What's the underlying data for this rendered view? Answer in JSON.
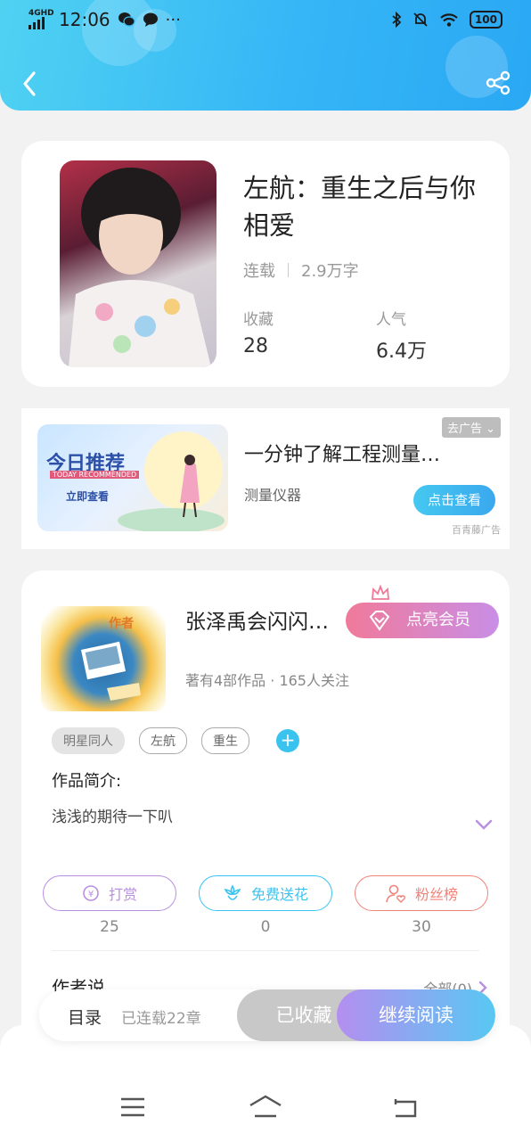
{
  "status_bar": {
    "network": "4GHD",
    "time": "12:06",
    "more": "···",
    "battery": "100"
  },
  "book": {
    "title": "左航：重生之后与你相爱",
    "status": "连载",
    "word_count": "2.9万字",
    "favorites_label": "收藏",
    "favorites_value": "28",
    "popularity_label": "人气",
    "popularity_value": "6.4万"
  },
  "ad": {
    "badge": "去广告",
    "banner_title": "今日推荐",
    "banner_en": "TODAY RECOMMENDED",
    "banner_cta": "立即查看",
    "title": "一分钟了解工程测量…",
    "subtitle": "测量仪器",
    "button": "点击查看",
    "source": "百青藤广告"
  },
  "author": {
    "avatar_badge": "作者",
    "name": "张泽禹会闪闪…",
    "vip_button": "点亮会员",
    "meta": "著有4部作品 · 165人关注",
    "tags": [
      "明星同人",
      "左航",
      "重生"
    ],
    "intro_label": "作品简介:",
    "intro_text": "浅浅的期待一下叭",
    "actions": [
      {
        "label": "打赏",
        "count": "25",
        "color": "#b98fe0"
      },
      {
        "label": "免费送花",
        "count": "0",
        "color": "#3bc3f0"
      },
      {
        "label": "粉丝榜",
        "count": "30",
        "color": "#f0837a"
      }
    ],
    "say_label": "作者说",
    "say_all": "全部(0)"
  },
  "bottom_bar": {
    "catalog_label": "目录",
    "catalog_count": "已连载22章",
    "saved_button": "已收藏",
    "read_button": "继续阅读"
  },
  "colors": {
    "header_start": "#4fd2f2",
    "header_end": "#2aa8f4",
    "accent": "#3bc3f0"
  }
}
